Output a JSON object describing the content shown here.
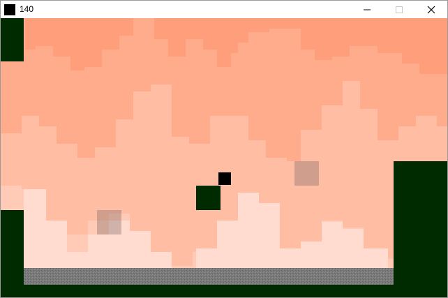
{
  "window": {
    "title": "140",
    "controls": {
      "minimize_icon": "minimize-icon",
      "maximize_icon": "maximize-icon",
      "close_icon": "close-icon"
    }
  },
  "scene": {
    "colors": {
      "sky_top": "#ff9e7a",
      "sky_mid": "#ffac8c",
      "sky_light": "#ffbea4",
      "sky_lighter": "#ffcab6",
      "sky_lightest": "#ffdccf",
      "wall_dark_green": "#002a00",
      "ground_gray": "#7a7a7a",
      "player": "#000000",
      "enemy_block": "#002a00",
      "ghost_block": "rgba(120,100,100,0.35)"
    }
  }
}
